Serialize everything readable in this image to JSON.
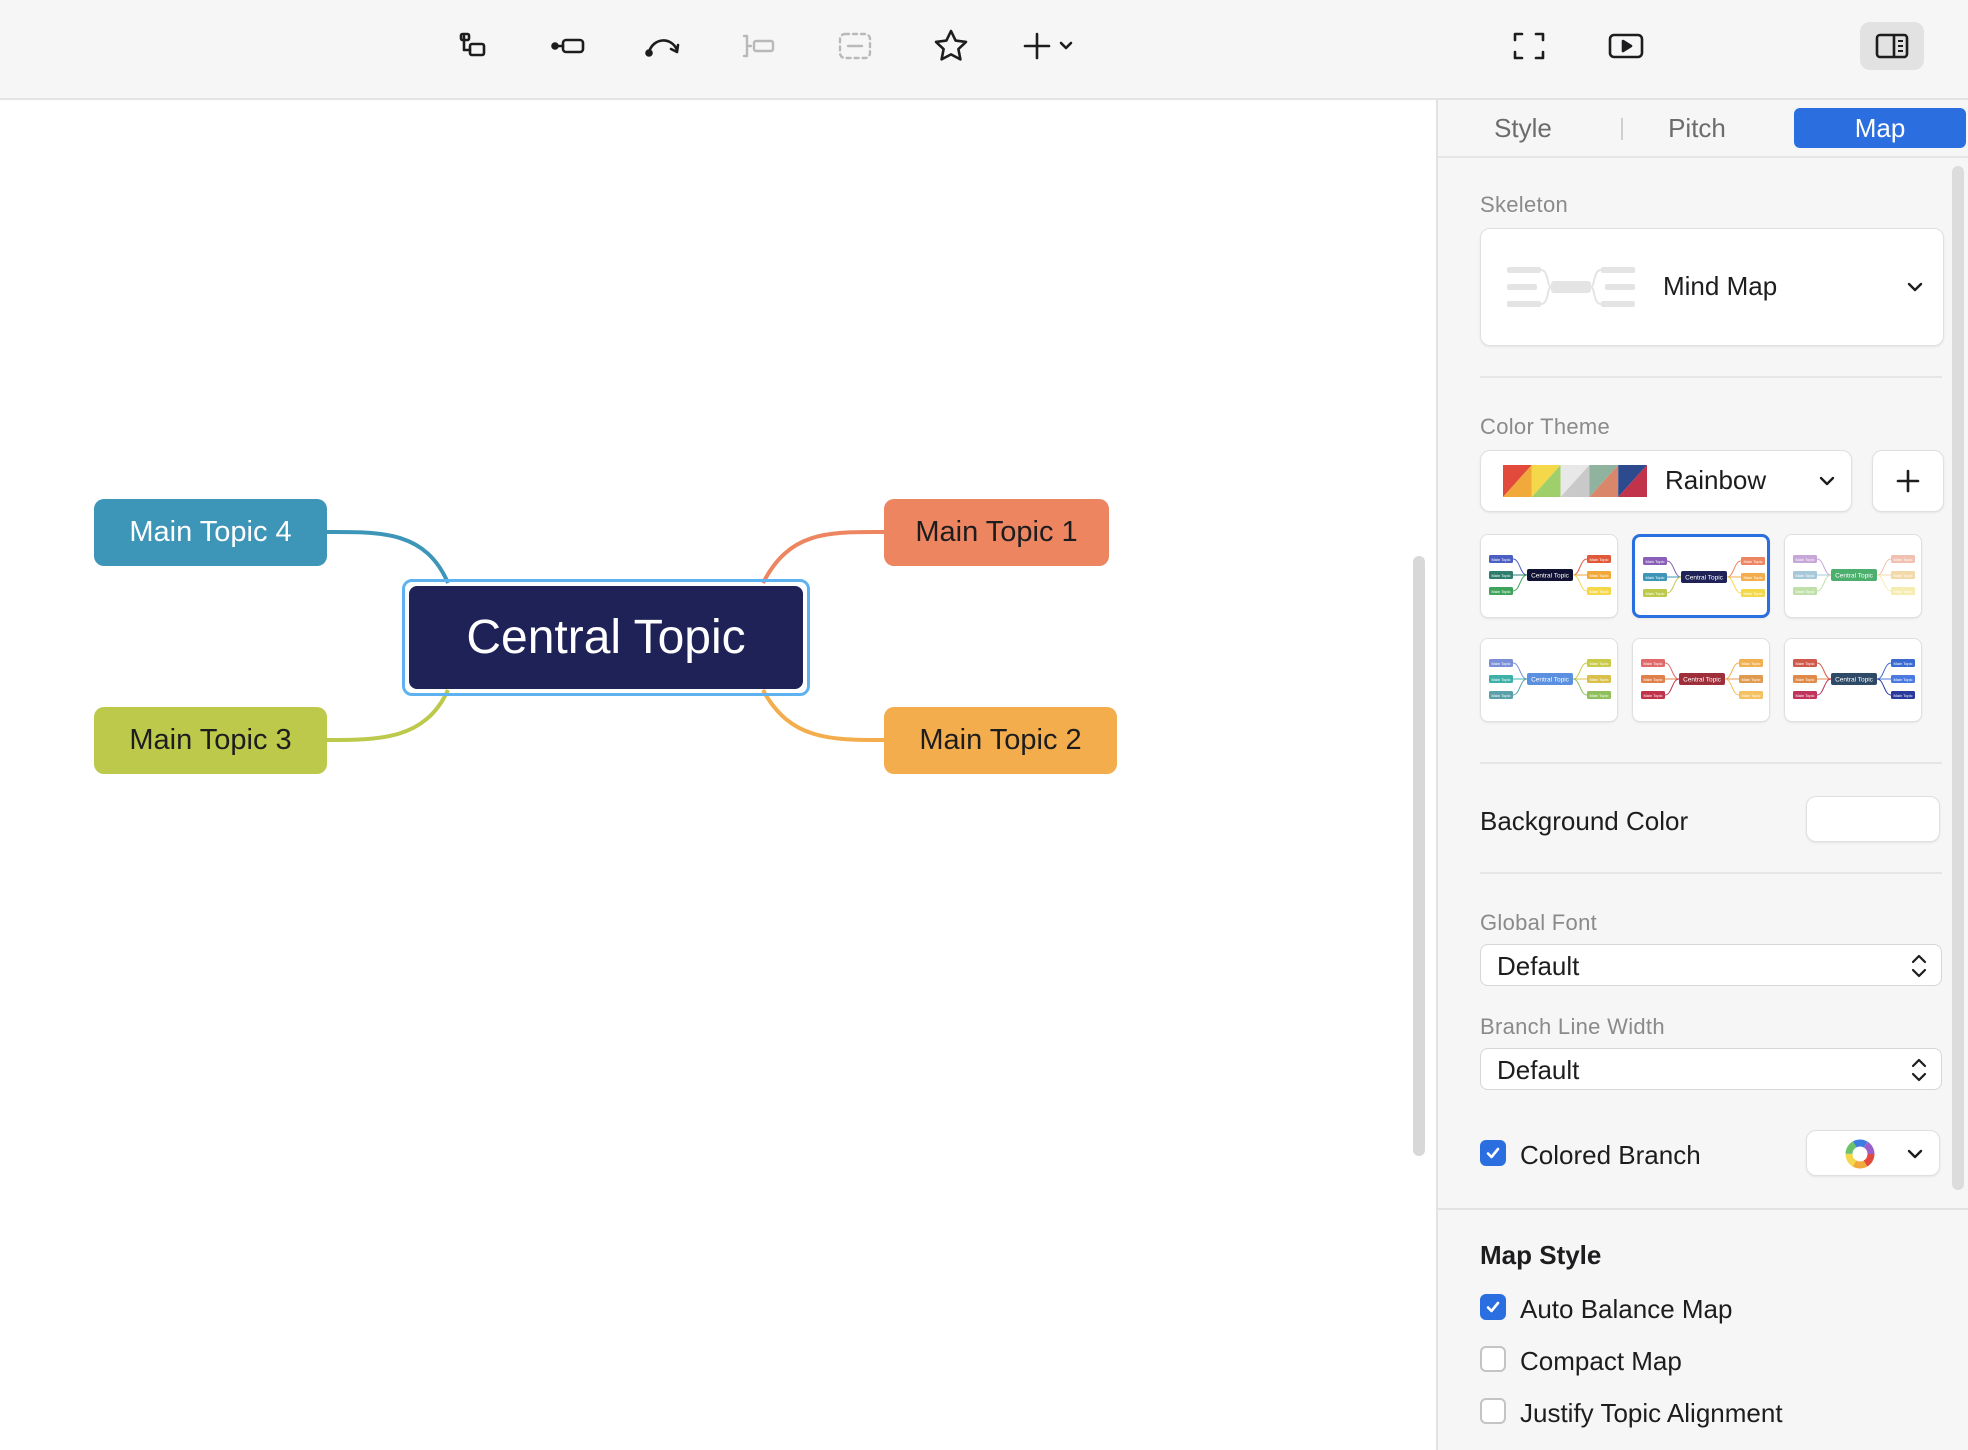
{
  "toolbar": {
    "tools": [
      {
        "name": "topic-icon"
      },
      {
        "name": "subtopic-icon"
      },
      {
        "name": "relationship-icon"
      },
      {
        "name": "summary-icon"
      },
      {
        "name": "boundary-icon"
      },
      {
        "name": "marker-star-icon"
      },
      {
        "name": "insert-plus-icon"
      },
      {
        "name": "zen-mode-icon"
      },
      {
        "name": "pitch-play-icon"
      },
      {
        "name": "format-panel-icon"
      }
    ]
  },
  "canvas": {
    "central": {
      "label": "Central Topic",
      "color": "#1e2257"
    },
    "topics": [
      {
        "label": "Main Topic 1",
        "color": "#ec8560",
        "text_color": "#1d1d1f"
      },
      {
        "label": "Main Topic 2",
        "color": "#f3ad4c",
        "text_color": "#1d1d1f"
      },
      {
        "label": "Main Topic 3",
        "color": "#bcc94a",
        "text_color": "#1d1d1f"
      },
      {
        "label": "Main Topic 4",
        "color": "#3d95b8",
        "text_color": "#ffffff"
      }
    ]
  },
  "panel": {
    "tabs": [
      {
        "label": "Style",
        "active": false
      },
      {
        "label": "Pitch",
        "active": false
      },
      {
        "label": "Map",
        "active": true
      }
    ],
    "skeleton": {
      "label": "Skeleton",
      "value": "Mind Map"
    },
    "color_theme": {
      "label": "Color Theme",
      "value": "Rainbow",
      "swatches": [
        "#e24a3b",
        "#f2a93b",
        "#f4d84a",
        "#9fcf6a",
        "#e8e8e8",
        "#c9c9c9",
        "#8fb39e",
        "#d9866a",
        "#2e4a8e",
        "#c0334a"
      ],
      "thumbnails": [
        {
          "central_text": "Central Topic",
          "topic_text": "Main Topic",
          "central": "#111133",
          "colors": [
            "#4a5fc1",
            "#2e7d6e",
            "#3fa35c",
            "#e05a3a",
            "#f2a93b",
            "#f4d84a"
          ],
          "selected": false
        },
        {
          "central_text": "Central Topic",
          "topic_text": "Main Topic",
          "central": "#1e2257",
          "colors": [
            "#8a5fb8",
            "#3d95b8",
            "#bcc94a",
            "#ec8560",
            "#f3ad4c",
            "#f4d84a"
          ],
          "selected": true
        },
        {
          "central_text": "Central Topic",
          "topic_text": "Main Topic",
          "central": "#4caf6e",
          "colors": [
            "#c7a6d8",
            "#a6c8d8",
            "#bfe0a8",
            "#f0c0b0",
            "#f3d8a8",
            "#f6ecb0"
          ],
          "selected": false
        },
        {
          "central_text": "Central Topic",
          "topic_text": "Main Topic",
          "central": "#5b8fe0",
          "colors": [
            "#7a8fd8",
            "#3fb0a8",
            "#5aa0a8",
            "#c9c94a",
            "#d8c04a",
            "#8fbf5a"
          ],
          "selected": false
        },
        {
          "central_text": "Central Topic",
          "topic_text": "Main Topic",
          "central": "#9e2f3a",
          "colors": [
            "#e06a6a",
            "#e0804a",
            "#c0334a",
            "#f0b050",
            "#e09a50",
            "#f4c060"
          ],
          "selected": false
        },
        {
          "central_text": "Central Topic",
          "topic_text": "Main Topic",
          "central": "#2f4a66",
          "colors": [
            "#d05a4a",
            "#e08a4a",
            "#c0335a",
            "#3a6ad0",
            "#4a7ae0",
            "#2a3a9a"
          ],
          "selected": false
        }
      ]
    },
    "background_color": {
      "label": "Background Color",
      "value": "#ffffff"
    },
    "global_font": {
      "label": "Global Font",
      "value": "Default"
    },
    "branch_line_width": {
      "label": "Branch Line Width",
      "value": "Default"
    },
    "colored_branch": {
      "label": "Colored Branch",
      "checked": true
    },
    "map_style": {
      "title": "Map Style",
      "options": [
        {
          "label": "Auto Balance Map",
          "checked": true
        },
        {
          "label": "Compact Map",
          "checked": false
        },
        {
          "label": "Justify Topic Alignment",
          "checked": false
        }
      ]
    }
  }
}
